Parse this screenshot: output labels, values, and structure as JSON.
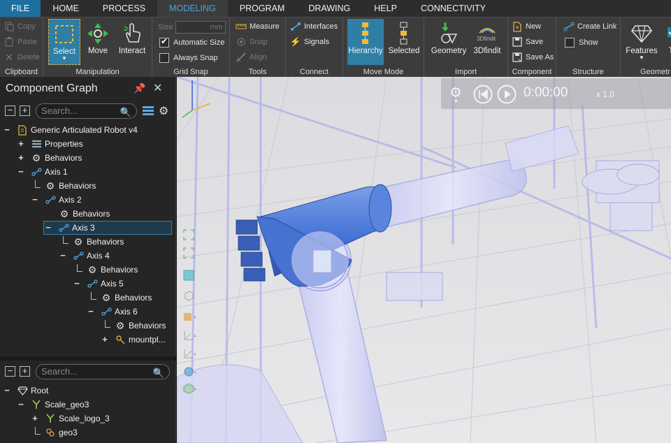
{
  "menu": {
    "tabs": [
      "FILE",
      "HOME",
      "PROCESS",
      "MODELING",
      "PROGRAM",
      "DRAWING",
      "HELP",
      "CONNECTIVITY"
    ]
  },
  "ribbon": {
    "clipboard": {
      "copy": "Copy",
      "paste": "Paste",
      "delete": "Delete",
      "label": "Clipboard"
    },
    "manipulation": {
      "select": "Select",
      "move": "Move",
      "interact": "Interact",
      "label": "Manipulation"
    },
    "grid_snap": {
      "size_label": "Size",
      "size_unit": "mm",
      "automatic_size": "Automatic Size",
      "always_snap": "Always Snap",
      "label": "Grid Snap",
      "automatic_size_checked": true,
      "always_snap_checked": false
    },
    "tools": {
      "measure": "Measure",
      "snap": "Snap",
      "align": "Align",
      "label": "Tools"
    },
    "connect": {
      "interfaces": "Interfaces",
      "signals": "Signals",
      "label": "Connect"
    },
    "move_mode": {
      "hierarchy": "Hierarchy",
      "selected": "Selected",
      "label": "Move Mode"
    },
    "import": {
      "geometry": "Geometry",
      "findit": "3Dfindit",
      "findit_logo": "3Dfindit",
      "label": "Import"
    },
    "component": {
      "new": "New",
      "save": "Save",
      "save_as": "Save As",
      "label": "Component"
    },
    "structure": {
      "create_link": "Create Link",
      "show": "Show",
      "label": "Structure"
    },
    "geometry": {
      "features": "Features",
      "next": "T",
      "label": "Geometr"
    }
  },
  "component_graph": {
    "title": "Component Graph",
    "search_placeholder": "Search...",
    "tree": [
      {
        "label": "Generic Articulated Robot v4",
        "toggle": "−",
        "icon": "component-icon"
      },
      {
        "label": "Properties",
        "toggle": "+",
        "icon": "properties-icon"
      },
      {
        "label": "Behaviors",
        "toggle": "+",
        "icon": "gear-icon"
      },
      {
        "label": "Axis 1",
        "toggle": "−",
        "icon": "link-icon"
      },
      {
        "label": "Behaviors",
        "toggle": "",
        "icon": "gear-icon"
      },
      {
        "label": "Axis 2",
        "toggle": "−",
        "icon": "link-icon"
      },
      {
        "label": "Behaviors",
        "toggle": "",
        "icon": "gear-icon"
      },
      {
        "label": "Axis 3",
        "toggle": "−",
        "icon": "link-icon",
        "selected": true
      },
      {
        "label": "Behaviors",
        "toggle": "",
        "icon": "gear-icon"
      },
      {
        "label": "Axis 4",
        "toggle": "−",
        "icon": "link-icon"
      },
      {
        "label": "Behaviors",
        "toggle": "",
        "icon": "gear-icon"
      },
      {
        "label": "Axis 5",
        "toggle": "−",
        "icon": "link-icon"
      },
      {
        "label": "Behaviors",
        "toggle": "",
        "icon": "gear-icon"
      },
      {
        "label": "Axis 6",
        "toggle": "−",
        "icon": "link-icon"
      },
      {
        "label": "Behaviors",
        "toggle": "",
        "icon": "gear-icon"
      },
      {
        "label": "mountpl...",
        "toggle": "+",
        "icon": "frame-icon"
      }
    ]
  },
  "geometry_tree": {
    "search_placeholder": "Search...",
    "tree": [
      {
        "label": "Root",
        "toggle": "−",
        "icon": "diamond-icon"
      },
      {
        "label": "Scale_geo3",
        "toggle": "−",
        "icon": "transform-icon"
      },
      {
        "label": "Scale_logo_3",
        "toggle": "+",
        "icon": "transform-icon"
      },
      {
        "label": "geo3",
        "toggle": "",
        "icon": "geometry-icon"
      }
    ]
  },
  "player": {
    "time": "0:00:00",
    "speed": "x 1.0"
  }
}
